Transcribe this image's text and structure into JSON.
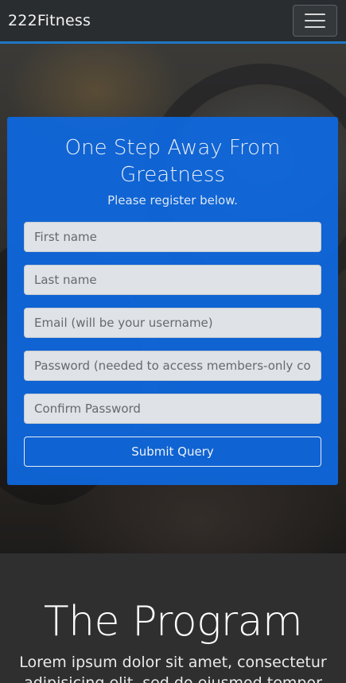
{
  "navbar": {
    "brand": "222Fitness",
    "toggle_icon": "hamburger-menu-icon"
  },
  "register": {
    "title": "One Step Away From Greatness",
    "subtitle": "Please register below.",
    "fields": {
      "first_name": {
        "placeholder": "First name",
        "value": ""
      },
      "last_name": {
        "placeholder": "Last name",
        "value": ""
      },
      "email": {
        "placeholder": "Email (will be your username)",
        "value": ""
      },
      "password": {
        "placeholder": "Password (needed to access members-only content)",
        "value": ""
      },
      "confirm_password": {
        "placeholder": "Confirm Password",
        "value": ""
      }
    },
    "submit_label": "Submit Query"
  },
  "program": {
    "title": "The Program",
    "text": "Lorem ipsum dolor sit amet, consectetur adipisicing elit, sed do eiusmod tempor incididunt"
  },
  "colors": {
    "navbar_bg": "#2a2d30",
    "navbar_border": "#1f78c4",
    "card_bg": "#0e68e0",
    "program_bg": "#2f2f30"
  }
}
